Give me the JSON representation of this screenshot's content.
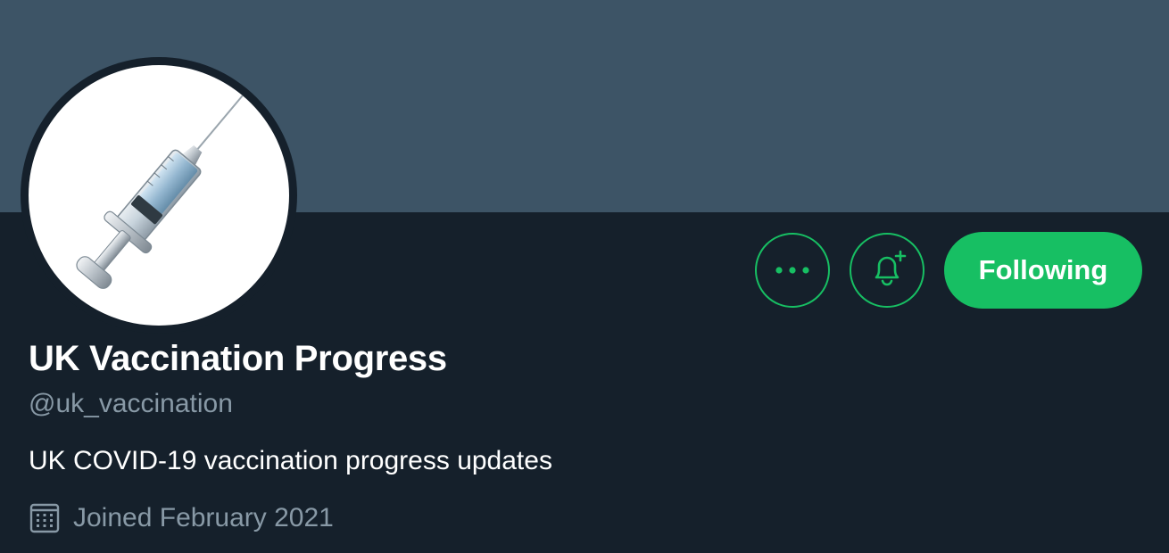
{
  "profile": {
    "display_name": "UK Vaccination Progress",
    "handle": "@uk_vaccination",
    "bio": "UK COVID-19 vaccination progress updates",
    "joined": "Joined February 2021",
    "avatar_icon": "syringe-icon"
  },
  "actions": {
    "more_icon": "more-dots-icon",
    "notify_icon": "bell-plus-icon",
    "following_label": "Following"
  },
  "colors": {
    "banner": "#3d5466",
    "background": "#15202b",
    "accent": "#17bf63",
    "secondary_text": "#8899a6",
    "primary_text": "#ffffff"
  }
}
